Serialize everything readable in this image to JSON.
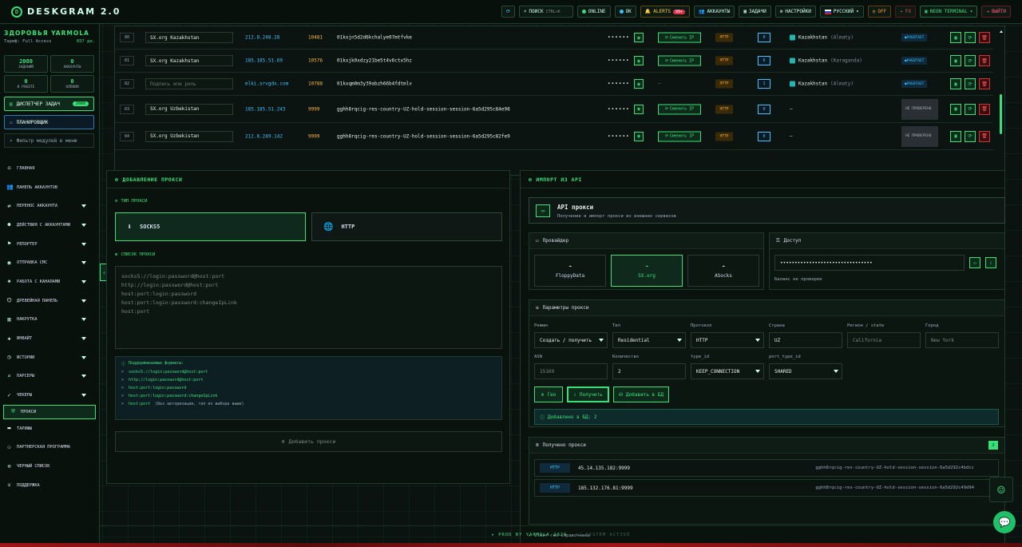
{
  "app": {
    "title": "DESKGRAM 2.0"
  },
  "topbar": {
    "refresh_icon": "refresh-icon",
    "search_label": "ПОИСК",
    "search_hint": "CTRL+K",
    "online_label": "ONLINE",
    "ok_label": "OK",
    "alerts_label": "ALERTS",
    "alerts_count": "99+",
    "accounts_label": "АККАУНТЫ",
    "tasks_label": "ЗАДАЧИ",
    "settings_label": "НАСТРОЙКИ",
    "language_label": "РУССКИЙ",
    "off_label": "OFF",
    "fx_label": "FX",
    "neon_label": "NEON TERMINAL",
    "exit_label": "ВЫЙТИ"
  },
  "sidebar": {
    "greeting": "ЗДОРОВЬЯ YARMOLA",
    "tariff_label": "Тариф: Full Access",
    "tariff_days": "657 дн.",
    "stats": [
      {
        "value": "2080",
        "label": "ЗАДАНИЙ"
      },
      {
        "value": "0",
        "label": "АККАУНТЫ"
      },
      {
        "value": "0",
        "label": "В РАБОТЕ"
      },
      {
        "value": "0",
        "label": "ОЛПОИЯ"
      }
    ],
    "dispatcher_label": "ДИСПЕТЧЕР ЗАДАЧ",
    "dispatcher_count": "2080",
    "scheduler_label": "ПЛАНИРОВЩИК",
    "filter_placeholder": "Фильтр модулей в меню",
    "items": [
      {
        "label": "ГЛАВНАЯ",
        "icon": "home-icon",
        "caret": false
      },
      {
        "label": "ПАНЕЛЬ АККАУНТОВ",
        "icon": "users-icon",
        "caret": false
      },
      {
        "label": "ПЕРЕНОС АККАУНТА",
        "icon": "transfer-icon",
        "caret": true
      },
      {
        "label": "ДЕЙСТВИЯ С АККАУНТАМИ",
        "icon": "people-icon",
        "caret": true
      },
      {
        "label": "РЕПОРТЕР",
        "icon": "flag-icon",
        "caret": true
      },
      {
        "label": "ОТПРАВКА СМС",
        "icon": "chat-icon",
        "caret": true
      },
      {
        "label": "РАБОТА С КАНАЛАМИ",
        "icon": "channel-icon",
        "caret": true
      },
      {
        "label": "ДРЕВЕЙНАЯ ПАНЕЛЬ",
        "icon": "tree-icon",
        "caret": true
      },
      {
        "label": "НАКРУТКА",
        "icon": "chart-icon",
        "caret": true
      },
      {
        "label": "ИНВАЙТ",
        "icon": "invite-icon",
        "caret": true
      },
      {
        "label": "ИСТОРИИ",
        "icon": "history-icon",
        "caret": true
      },
      {
        "label": "ПАРСЕРЫ",
        "icon": "search-icon",
        "caret": true
      },
      {
        "label": "ЧЕКЕРЫ",
        "icon": "check-icon",
        "caret": true
      },
      {
        "label": "ПРОКСИ",
        "icon": "shield-icon",
        "caret": false,
        "active": true
      },
      {
        "label": "ТАРИФЫ",
        "icon": "card-icon",
        "caret": false
      },
      {
        "label": "ПАРТНЕРСКАЯ ПРОГРАММА",
        "icon": "partners-icon",
        "caret": false
      },
      {
        "label": "ЧЕРНЫЙ СПИСОК",
        "icon": "block-icon",
        "caret": false
      },
      {
        "label": "ПОДДЕРЖКА",
        "icon": "support-icon",
        "caret": false
      }
    ]
  },
  "proxy_table": {
    "rows": [
      {
        "id": "80",
        "name": "SX.org Kazakhstan",
        "ip": "212.8.248.28",
        "port": "10481",
        "login": "01kxjn5d2d6kchalye07mtfvke",
        "password": "••••••",
        "action": "Сменить IP",
        "protocol": "HTTP",
        "count": "0",
        "country": "Kazakhstan",
        "city": "(Almaty)",
        "status": "РАБОТАЕТ"
      },
      {
        "id": "81",
        "name": "SX.org Kazakhstan",
        "ip": "185.185.51.69",
        "port": "10576",
        "login": "01kxjk0xdzy21be5t4v6ctx5hz",
        "password": "••••••",
        "action": "Сменить IP",
        "protocol": "HTTP",
        "count": "0",
        "country": "Kazakhstan",
        "city": "(Karaganda)",
        "status": "РАБОТАЕТ"
      },
      {
        "id": "82",
        "name": "Подпись или роль",
        "ip": "mlki.srvgdx.com",
        "port": "10788",
        "login": "01kxqm0m3y39abzh66b4fdtmlv",
        "password": "••••••",
        "action": "—",
        "protocol": "HTTP",
        "count": "1",
        "country": "Kazakhstan",
        "city": "(Almaty)",
        "status": "РАБОТАЕТ"
      },
      {
        "id": "83",
        "name": "SX.org Uzbekistan",
        "ip": "185.185.51.243",
        "port": "9999",
        "login": "gghh8rqcig-res-country-UZ-hold-session-session-6a5d295c84e98",
        "password": "••••••",
        "action": "Сменить IP",
        "protocol": "HTTP",
        "count": "0",
        "country": "—",
        "city": "",
        "status": "НЕ ПРОВЕРЕНО"
      },
      {
        "id": "84",
        "name": "SX.org Uzbekistan",
        "ip": "212.8.249.142",
        "port": "9999",
        "login": "gghh8rqcig-res-country-UZ-hold-session-session-6a5d295c82fe9",
        "password": "••••••",
        "action": "Сменить IP",
        "protocol": "HTTP",
        "count": "0",
        "country": "—",
        "city": "",
        "status": "НЕ ПРОВЕРЕНО"
      }
    ]
  },
  "add_proxy": {
    "title": "ДОБАВЛЕНИЕ ПРОКСИ",
    "type_label": "ТИП ПРОКСИ",
    "type_socks": "SOCKS5",
    "type_http": "HTTP",
    "list_label": "СПИСОК ПРОКСИ",
    "placeholder_lines": [
      "socks5://login:password@host:port",
      "http://login:password@host:port",
      "host:port:login:password",
      "host:port:login:password:changeIpLink",
      "host:port"
    ],
    "formats_title": "Поддерживаемые форматы:",
    "formats": [
      {
        "fmt": "socks5://login:password@host:port",
        "note": ""
      },
      {
        "fmt": "http://login:password@host:port",
        "note": ""
      },
      {
        "fmt": "host:port:login:password",
        "note": ""
      },
      {
        "fmt": "host:port:login:password:changeIpLink",
        "note": ""
      },
      {
        "fmt": "host:port",
        "note": "(Без авторизации, тип из выбора выше)"
      }
    ],
    "submit_label": "Добавить прокси"
  },
  "import_api": {
    "title": "ИМПОРТ ИЗ API",
    "api_title": "API прокси",
    "api_subtitle": "Получение и импорт прокси из внешних сервисов",
    "provider_label": "Провайдер",
    "providers": [
      {
        "name": "FloppyData"
      },
      {
        "name": "SX.org",
        "selected": true
      },
      {
        "name": "ASocks"
      }
    ],
    "access_label": "Доступ",
    "access_value": "••••••••••••••••••••••••••••••••",
    "balance_note": "Баланс не проверен",
    "params_label": "Параметры прокси",
    "fields": {
      "mode_label": "Режим",
      "mode_value": "Создать / получить",
      "type_label": "Тип",
      "type_value": "Residential",
      "protocol_label": "Протокол",
      "protocol_value": "HTTP",
      "country_label": "Страна",
      "country_value": "UZ",
      "region_label": "Регион / state",
      "region_value": "California",
      "city_label": "Город",
      "city_value": "New York",
      "asn_label": "ASN",
      "asn_value": "15169",
      "qty_label": "Количество",
      "qty_value": "2",
      "type_id_label": "type_id",
      "type_id_value": "KEEP_CONNECTION",
      "port_type_label": "port_type_id",
      "port_type_value": "SHARED"
    },
    "btn_geo": "Гео",
    "btn_get": "Получить",
    "btn_add_db": "Добавить в БД",
    "added_note": "Добавлено в БД: 2",
    "received_label": "Получено прокси",
    "received_count": "2",
    "received": [
      {
        "protocol": "HTTP",
        "address": "45.14.135.182:9999",
        "login": "gghh8rqcig-res-country-UZ-hold-session-session-6a5d292c4bdcc"
      },
      {
        "protocol": "HTTP",
        "address": "185.132.176.81:9999",
        "login": "gghh8rqcig-res-country-UZ-hold-session-session-6a5d292c49d94"
      }
    ],
    "geo_toggle": "Ответ гео-справочника"
  },
  "footer": {
    "text": "▸ PROD BY YARMOLA 2026",
    "status": "// SYSTEM ACTIVE"
  },
  "colors": {
    "accent": "#39e07a",
    "ip": "#3ec0ff",
    "port": "#ffb640",
    "danger": "#ff5a5a"
  }
}
